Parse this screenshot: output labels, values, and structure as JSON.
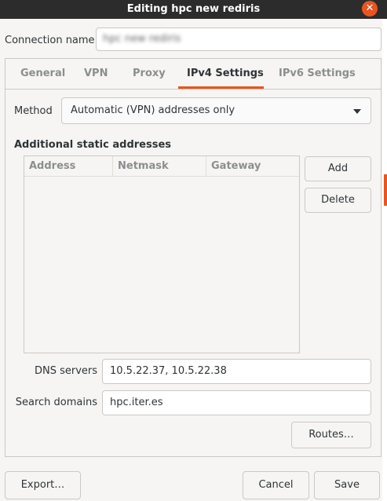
{
  "window": {
    "title": "Editing hpc new rediris"
  },
  "connection": {
    "label": "Connection name",
    "value": "hpc new rediris"
  },
  "tabs": [
    {
      "label": "General",
      "active": false
    },
    {
      "label": "VPN",
      "active": false
    },
    {
      "label": "Proxy",
      "active": false
    },
    {
      "label": "IPv4 Settings",
      "active": true
    },
    {
      "label": "IPv6 Settings",
      "active": false
    }
  ],
  "method": {
    "label": "Method",
    "value": "Automatic (VPN) addresses only"
  },
  "addresses": {
    "title": "Additional static addresses",
    "columns": [
      "Address",
      "Netmask",
      "Gateway"
    ],
    "rows": [],
    "add_label": "Add",
    "delete_label": "Delete"
  },
  "dns": {
    "label": "DNS servers",
    "value": "10.5.22.37, 10.5.22.38"
  },
  "search_domains": {
    "label": "Search domains",
    "value": "hpc.iter.es"
  },
  "routes_label": "Routes…",
  "footer": {
    "export_label": "Export…",
    "cancel_label": "Cancel",
    "save_label": "Save"
  },
  "colors": {
    "accent": "#e95420",
    "titlebar": "#2c2c2c",
    "background": "#f6f5f4"
  }
}
